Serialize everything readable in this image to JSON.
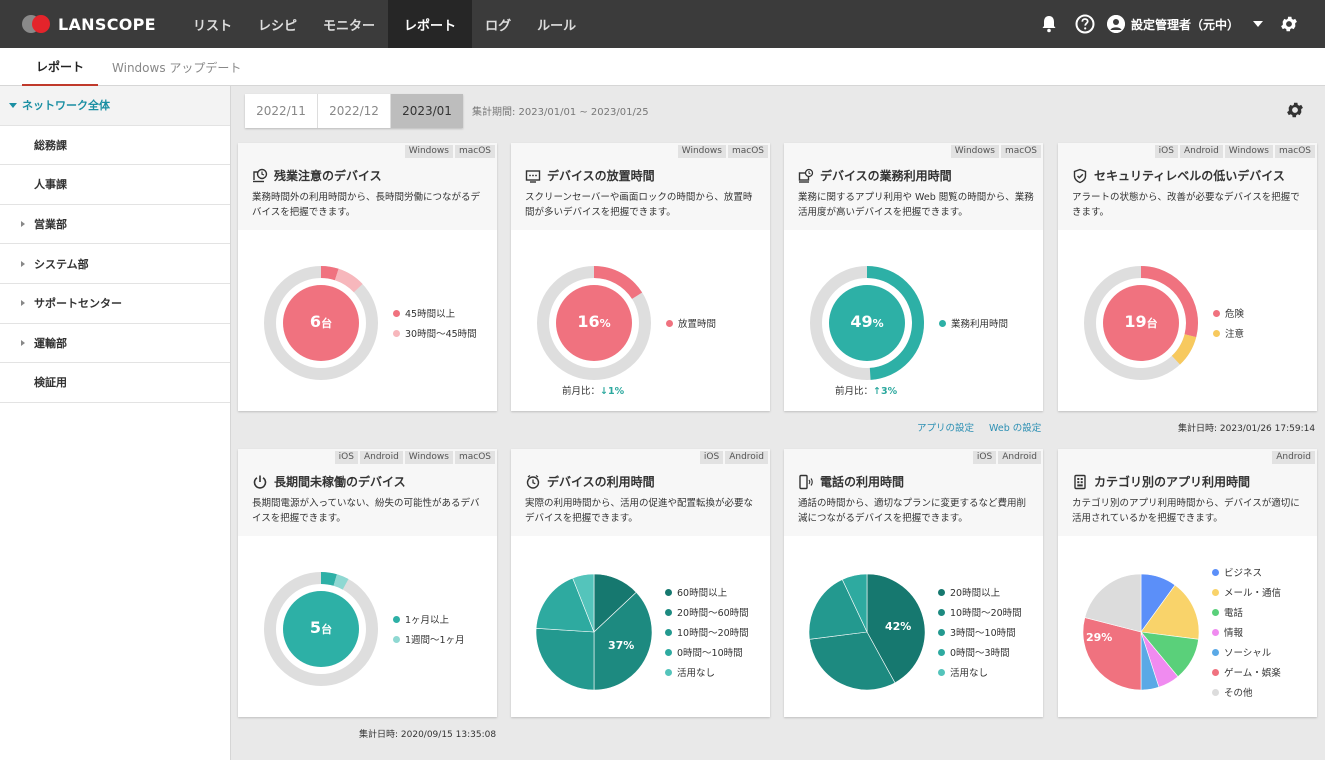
{
  "app": {
    "logo": "LANSCOPE",
    "nav": [
      "リスト",
      "レシピ",
      "モニター",
      "レポート",
      "ログ",
      "ルール"
    ],
    "active_nav": 3,
    "user": "設定管理者（元中）"
  },
  "subtabs": [
    "レポート",
    "Windows アップデート"
  ],
  "sidebar": {
    "items": [
      {
        "label": "ネットワーク全体",
        "expandable": true,
        "root": true
      },
      {
        "label": "総務課",
        "expandable": false
      },
      {
        "label": "人事課",
        "expandable": false
      },
      {
        "label": "営業部",
        "expandable": true
      },
      {
        "label": "システム部",
        "expandable": true
      },
      {
        "label": "サポートセンター",
        "expandable": true
      },
      {
        "label": "運輸部",
        "expandable": true
      },
      {
        "label": "検証用",
        "expandable": false
      }
    ]
  },
  "period": {
    "tabs": [
      "2022/11",
      "2022/12",
      "2023/01"
    ],
    "active": 2,
    "label": "集計期間: 2023/01/01 ~ 2023/01/25"
  },
  "cards": [
    {
      "title": "残業注意のデバイス",
      "desc": "業務時間外の利用時間から、長時間労働につながるデバイスを把握できます。",
      "os": [
        "Windows",
        "macOS"
      ],
      "center_value": "6",
      "center_unit": "台",
      "legend": [
        {
          "label": "45時間以上",
          "color": "#f0727f"
        },
        {
          "label": "30時間〜45時間",
          "color": "#f7b7bc"
        }
      ],
      "segments": [
        0.05,
        0.08
      ]
    },
    {
      "title": "デバイスの放置時間",
      "desc": "スクリーンセーバーや画面ロックの時間から、放置時間が多いデバイスを把握できます。",
      "os": [
        "Windows",
        "macOS"
      ],
      "center_value": "16",
      "center_unit": "%",
      "legend": [
        {
          "label": "放置時間",
          "color": "#f0727f"
        }
      ],
      "segments": [
        0.16
      ],
      "mom_label": "前月比：",
      "mom_delta": "↓1%"
    },
    {
      "title": "デバイスの業務利用時間",
      "desc": "業務に関するアプリ利用や Web 閲覧の時間から、業務活用度が高いデバイスを把握できます。",
      "os": [
        "Windows",
        "macOS"
      ],
      "center_value": "49",
      "center_unit": "%",
      "legend": [
        {
          "label": "業務利用時間",
          "color": "#2db0a6"
        }
      ],
      "segments": [
        0.49
      ],
      "mom_label": "前月比：",
      "mom_delta": "↑3%"
    },
    {
      "title": "セキュリティレベルの低いデバイス",
      "desc": "アラートの状態から、改善が必要なデバイスを把握できます。",
      "os": [
        "iOS",
        "Android",
        "Windows",
        "macOS"
      ],
      "center_value": "19",
      "center_unit": "台",
      "legend": [
        {
          "label": "危険",
          "color": "#f0727f"
        },
        {
          "label": "注意",
          "color": "#f7c95e"
        }
      ],
      "segments": [
        0.29,
        0.09
      ]
    },
    {
      "title": "長期間未稼働のデバイス",
      "desc": "長期間電源が入っていない、紛失の可能性があるデバイスを把握できます。",
      "os": [
        "iOS",
        "Android",
        "Windows",
        "macOS"
      ],
      "center_value": "5",
      "center_unit": "台",
      "legend": [
        {
          "label": "1ヶ月以上",
          "color": "#2db0a6"
        },
        {
          "label": "1週間〜1ヶ月",
          "color": "#8fd8d2"
        }
      ],
      "segments": [
        0.045,
        0.035
      ]
    },
    {
      "title": "デバイスの利用時間",
      "desc": "実際の利用時間から、活用の促進や配置転換が必要なデバイスを把握できます。",
      "os": [
        "iOS",
        "Android"
      ],
      "pie_label": "37%",
      "legend": [
        {
          "label": "60時間以上",
          "color": "#16786f"
        },
        {
          "label": "20時間〜60時間",
          "color": "#1d8a80"
        },
        {
          "label": "10時間〜20時間",
          "color": "#23998f"
        },
        {
          "label": "0時間〜10時間",
          "color": "#2eaaa0"
        },
        {
          "label": "活用なし",
          "color": "#54c4bb"
        }
      ],
      "pie": [
        0.13,
        0.37,
        0.26,
        0.18,
        0.06
      ]
    },
    {
      "title": "電話の利用時間",
      "desc": "通話の時間から、適切なプランに変更するなど費用削減につながるデバイスを把握できます。",
      "os": [
        "iOS",
        "Android"
      ],
      "pie_label": "42%",
      "legend": [
        {
          "label": "20時間以上",
          "color": "#16786f"
        },
        {
          "label": "10時間〜20時間",
          "color": "#1d8a80"
        },
        {
          "label": "3時間〜10時間",
          "color": "#23998f"
        },
        {
          "label": "0時間〜3時間",
          "color": "#2eaaa0"
        },
        {
          "label": "活用なし",
          "color": "#54c4bb"
        }
      ],
      "pie": [
        0.42,
        0.31,
        0.2,
        0.07
      ]
    },
    {
      "title": "カテゴリ別のアプリ利用時間",
      "desc": "カテゴリ別のアプリ利用時間から、デバイスが適切に活用されているかを把握できます。",
      "os": [
        "Android"
      ],
      "pie_label": "29%",
      "legend": [
        {
          "label": "ビジネス",
          "color": "#5b8ff9"
        },
        {
          "label": "メール・通信",
          "color": "#f9d36a"
        },
        {
          "label": "電話",
          "color": "#5ad07a"
        },
        {
          "label": "情報",
          "color": "#f08bf0"
        },
        {
          "label": "ソーシャル",
          "color": "#5aa9e6"
        },
        {
          "label": "ゲーム・娯楽",
          "color": "#f0727f"
        },
        {
          "label": "その他",
          "color": "#dcdcdc"
        }
      ],
      "pie": [
        0.1,
        0.17,
        0.12,
        0.06,
        0.05,
        0.29,
        0.21
      ]
    }
  ],
  "links": {
    "app": "アプリの設定",
    "web": "Web の設定"
  },
  "stamps": {
    "row1": "集計日時: 2023/01/26 17:59:14",
    "row2": "集計日時: 2020/09/15 13:35:08"
  }
}
